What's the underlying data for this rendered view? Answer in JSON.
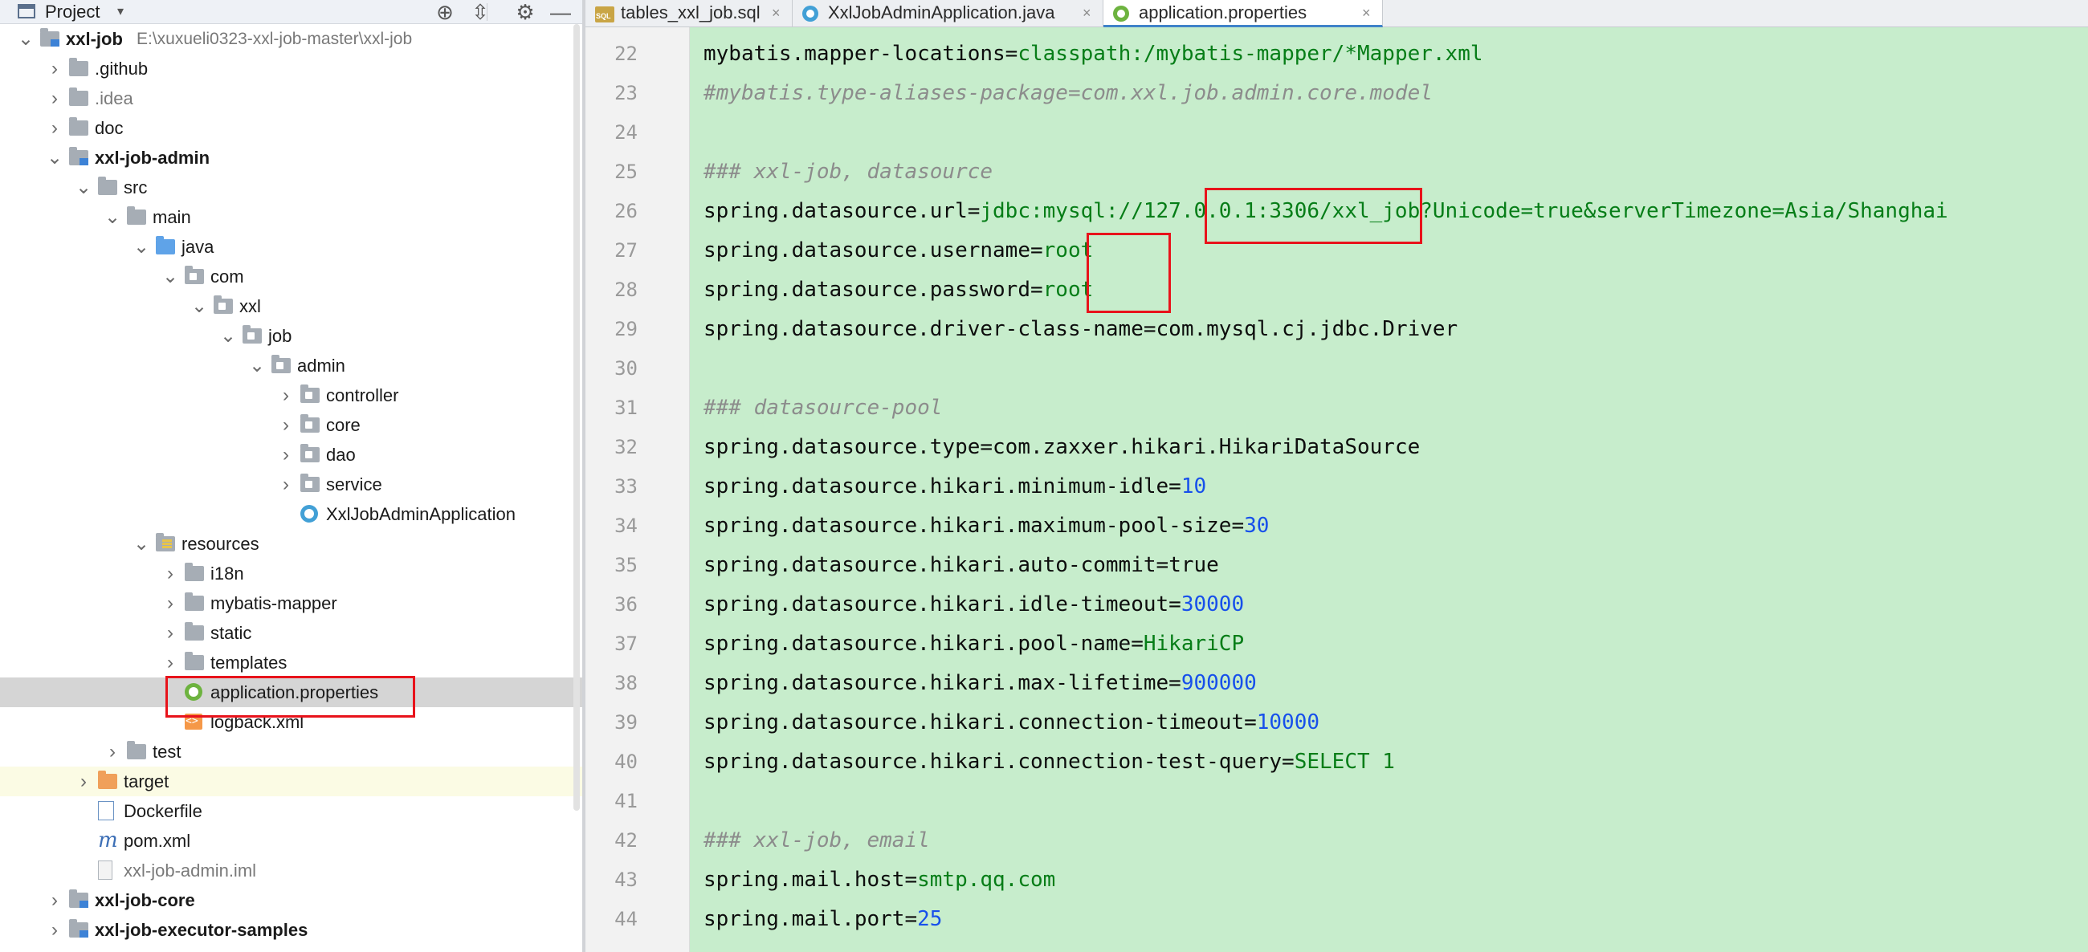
{
  "project_panel": {
    "title": "Project",
    "caret": "▾",
    "tools": [
      "⊕",
      "⇳",
      "⚙",
      "—"
    ],
    "tree": [
      {
        "label": "xxl-job",
        "path": "E:\\xuxueli0323-xxl-job-master\\xxl-job",
        "indent": 0,
        "arrow": "⌄",
        "icon": "module",
        "bold": true
      },
      {
        "label": ".github",
        "indent": 1,
        "arrow": "›",
        "icon": "folder"
      },
      {
        "label": ".idea",
        "indent": 1,
        "arrow": "›",
        "icon": "folder",
        "dim": true
      },
      {
        "label": "doc",
        "indent": 1,
        "arrow": "›",
        "icon": "folder"
      },
      {
        "label": "xxl-job-admin",
        "indent": 1,
        "arrow": "⌄",
        "icon": "module",
        "bold": true
      },
      {
        "label": "src",
        "indent": 2,
        "arrow": "⌄",
        "icon": "folder"
      },
      {
        "label": "main",
        "indent": 3,
        "arrow": "⌄",
        "icon": "folder"
      },
      {
        "label": "java",
        "indent": 4,
        "arrow": "⌄",
        "icon": "folder-blue"
      },
      {
        "label": "com",
        "indent": 5,
        "arrow": "⌄",
        "icon": "package"
      },
      {
        "label": "xxl",
        "indent": 6,
        "arrow": "⌄",
        "icon": "package"
      },
      {
        "label": "job",
        "indent": 7,
        "arrow": "⌄",
        "icon": "package"
      },
      {
        "label": "admin",
        "indent": 8,
        "arrow": "⌄",
        "icon": "package"
      },
      {
        "label": "controller",
        "indent": 9,
        "arrow": "›",
        "icon": "package"
      },
      {
        "label": "core",
        "indent": 9,
        "arrow": "›",
        "icon": "package"
      },
      {
        "label": "dao",
        "indent": 9,
        "arrow": "›",
        "icon": "package"
      },
      {
        "label": "service",
        "indent": 9,
        "arrow": "›",
        "icon": "package"
      },
      {
        "label": "XxlJobAdminApplication",
        "indent": 9,
        "arrow": "",
        "icon": "spring-class"
      },
      {
        "label": "resources",
        "indent": 4,
        "arrow": "⌄",
        "icon": "resources"
      },
      {
        "label": "i18n",
        "indent": 5,
        "arrow": "›",
        "icon": "folder"
      },
      {
        "label": "mybatis-mapper",
        "indent": 5,
        "arrow": "›",
        "icon": "folder"
      },
      {
        "label": "static",
        "indent": 5,
        "arrow": "›",
        "icon": "folder"
      },
      {
        "label": "templates",
        "indent": 5,
        "arrow": "›",
        "icon": "folder"
      },
      {
        "label": "application.properties",
        "indent": 5,
        "arrow": "",
        "icon": "spring-properties",
        "selected": true
      },
      {
        "label": "logback.xml",
        "indent": 5,
        "arrow": "",
        "icon": "xml"
      },
      {
        "label": "test",
        "indent": 3,
        "arrow": "›",
        "icon": "folder"
      },
      {
        "label": "target",
        "indent": 2,
        "arrow": "›",
        "icon": "folder-orange",
        "highlight": true
      },
      {
        "label": "Dockerfile",
        "indent": 2,
        "arrow": "",
        "icon": "docker"
      },
      {
        "label": "pom.xml",
        "indent": 2,
        "arrow": "",
        "icon": "maven"
      },
      {
        "label": "xxl-job-admin.iml",
        "indent": 2,
        "arrow": "",
        "icon": "iml",
        "dim": true
      },
      {
        "label": "xxl-job-core",
        "indent": 1,
        "arrow": "›",
        "icon": "module",
        "bold": true
      },
      {
        "label": "xxl-job-executor-samples",
        "indent": 1,
        "arrow": "›",
        "icon": "module",
        "bold": true
      }
    ]
  },
  "editor": {
    "tabs": [
      {
        "label": "tables_xxl_job.sql",
        "icon": "sql-icon",
        "close": "×",
        "active": false
      },
      {
        "label": "XxlJobAdminApplication.java",
        "icon": "java-class-icon",
        "close": "×",
        "active": false
      },
      {
        "label": "application.properties",
        "icon": "properties-icon",
        "close": "×",
        "active": true
      }
    ],
    "lines": [
      {
        "num": "22",
        "parts": [
          {
            "t": "mybatis.mapper-locations=",
            "c": ""
          },
          {
            "t": "classpath:/mybatis-mapper/*Mapper.xml",
            "c": "v"
          }
        ]
      },
      {
        "num": "23",
        "parts": [
          {
            "t": "#mybatis.type-aliases-package=com.xxl.job.admin.core.model",
            "c": "c"
          }
        ]
      },
      {
        "num": "24",
        "parts": []
      },
      {
        "num": "25",
        "parts": [
          {
            "t": "### xxl-job, datasource",
            "c": "c"
          }
        ]
      },
      {
        "num": "26",
        "parts": [
          {
            "t": "spring.datasource.url=",
            "c": ""
          },
          {
            "t": "jdbc:mysql://127.0.0.1:3306/xxl_job?Unicode=true&serverTimezone=Asia/Shanghai",
            "c": "v"
          }
        ]
      },
      {
        "num": "27",
        "parts": [
          {
            "t": "spring.datasource.username=",
            "c": ""
          },
          {
            "t": "root",
            "c": "v"
          }
        ]
      },
      {
        "num": "28",
        "parts": [
          {
            "t": "spring.datasource.password=",
            "c": ""
          },
          {
            "t": "root",
            "c": "v"
          }
        ]
      },
      {
        "num": "29",
        "parts": [
          {
            "t": "spring.datasource.driver-class-name=",
            "c": ""
          },
          {
            "t": "com.mysql.cj.jdbc.Driver",
            "c": ""
          }
        ]
      },
      {
        "num": "30",
        "parts": []
      },
      {
        "num": "31",
        "parts": [
          {
            "t": "### datasource-pool",
            "c": "c"
          }
        ]
      },
      {
        "num": "32",
        "parts": [
          {
            "t": "spring.datasource.type=",
            "c": ""
          },
          {
            "t": "com.zaxxer.hikari.HikariDataSource",
            "c": ""
          }
        ]
      },
      {
        "num": "33",
        "parts": [
          {
            "t": "spring.datasource.hikari.minimum-idle=",
            "c": ""
          },
          {
            "t": "10",
            "c": "n"
          }
        ]
      },
      {
        "num": "34",
        "parts": [
          {
            "t": "spring.datasource.hikari.maximum-pool-size=",
            "c": ""
          },
          {
            "t": "30",
            "c": "n"
          }
        ]
      },
      {
        "num": "35",
        "parts": [
          {
            "t": "spring.datasource.hikari.auto-commit=",
            "c": ""
          },
          {
            "t": "true",
            "c": ""
          }
        ]
      },
      {
        "num": "36",
        "parts": [
          {
            "t": "spring.datasource.hikari.idle-timeout=",
            "c": ""
          },
          {
            "t": "30000",
            "c": "n"
          }
        ]
      },
      {
        "num": "37",
        "parts": [
          {
            "t": "spring.datasource.hikari.pool-name=",
            "c": ""
          },
          {
            "t": "HikariCP",
            "c": "v"
          }
        ]
      },
      {
        "num": "38",
        "parts": [
          {
            "t": "spring.datasource.hikari.max-lifetime=",
            "c": ""
          },
          {
            "t": "900000",
            "c": "n"
          }
        ]
      },
      {
        "num": "39",
        "parts": [
          {
            "t": "spring.datasource.hikari.connection-timeout=",
            "c": ""
          },
          {
            "t": "10000",
            "c": "n"
          }
        ]
      },
      {
        "num": "40",
        "parts": [
          {
            "t": "spring.datasource.hikari.connection-test-query=",
            "c": ""
          },
          {
            "t": "SELECT 1",
            "c": "v"
          }
        ]
      },
      {
        "num": "41",
        "parts": []
      },
      {
        "num": "42",
        "parts": [
          {
            "t": "### xxl-job, email",
            "c": "c"
          }
        ]
      },
      {
        "num": "43",
        "parts": [
          {
            "t": "spring.mail.host=",
            "c": ""
          },
          {
            "t": "smtp.qq.com",
            "c": "v"
          }
        ]
      },
      {
        "num": "44",
        "parts": [
          {
            "t": "spring.mail.port=",
            "c": ""
          },
          {
            "t": "25",
            "c": "n"
          }
        ]
      }
    ]
  },
  "colors": {
    "editor_background": "#c7edcc",
    "annotation_box": "#e8131b",
    "string_value": "#067d17",
    "number_value": "#1750eb",
    "comment": "#8c8c8c"
  }
}
